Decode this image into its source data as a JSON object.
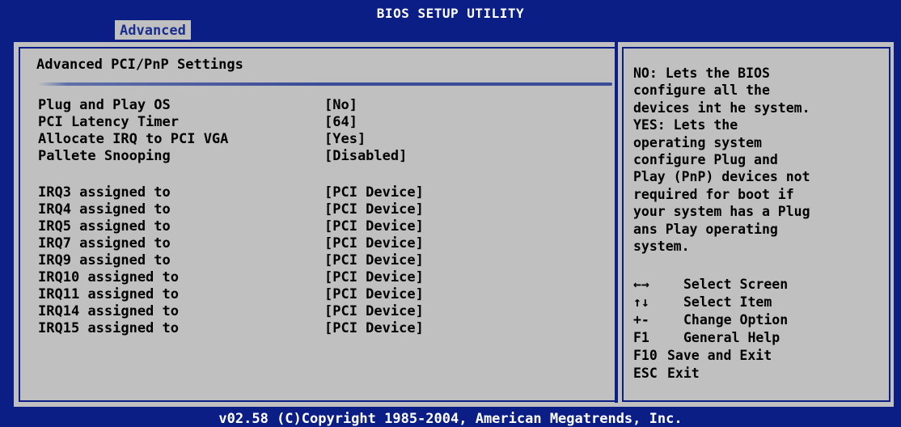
{
  "header": {
    "title": "BIOS SETUP UTILITY",
    "tab": "Advanced"
  },
  "main": {
    "section_title": "Advanced PCI/PnP Settings",
    "settings": [
      {
        "label": "Plug and Play OS",
        "value": "[No]"
      },
      {
        "label": "PCI Latency Timer",
        "value": "[64]"
      },
      {
        "label": "Allocate IRQ to PCI VGA",
        "value": "[Yes]"
      },
      {
        "label": "Pallete Snooping",
        "value": "[Disabled]"
      }
    ],
    "irq": [
      {
        "label": "IRQ3 assigned to",
        "value": "[PCI Device]"
      },
      {
        "label": "IRQ4 assigned to",
        "value": "[PCI Device]"
      },
      {
        "label": "IRQ5 assigned to",
        "value": "[PCI Device]"
      },
      {
        "label": "IRQ7 assigned to",
        "value": "[PCI Device]"
      },
      {
        "label": "IRQ9 assigned to",
        "value": "[PCI Device]"
      },
      {
        "label": "IRQ10 assigned to",
        "value": "[PCI Device]"
      },
      {
        "label": "IRQ11 assigned to",
        "value": "[PCI Device]"
      },
      {
        "label": "IRQ14 assigned to",
        "value": "[PCI Device]"
      },
      {
        "label": "IRQ15 assigned to",
        "value": "[PCI Device]"
      }
    ]
  },
  "help": {
    "text": "NO: Lets the BIOS\nconfigure all the\ndevices int he system.\nYES: Lets the\noperating system\nconfigure Plug and\nPlay (PnP) devices not\nrequired for boot if\nyour system has a Plug\nans Play operating\nsystem.",
    "keys": [
      {
        "key": "←→",
        "desc": "Select Screen"
      },
      {
        "key": "↑↓",
        "desc": "Select Item"
      },
      {
        "key": "+-",
        "desc": "Change Option"
      },
      {
        "key": "F1",
        "desc": "General Help"
      },
      {
        "key": "F10",
        "desc": "Save and Exit"
      },
      {
        "key": "ESC",
        "desc": "Exit"
      }
    ]
  },
  "footer": "v02.58 (C)Copyright 1985-2004, American Megatrends, Inc.",
  "colors": {
    "background": "#0b1e86",
    "panel": "#c0c0c0",
    "text": "#000000",
    "header_text": "#ffffff"
  }
}
